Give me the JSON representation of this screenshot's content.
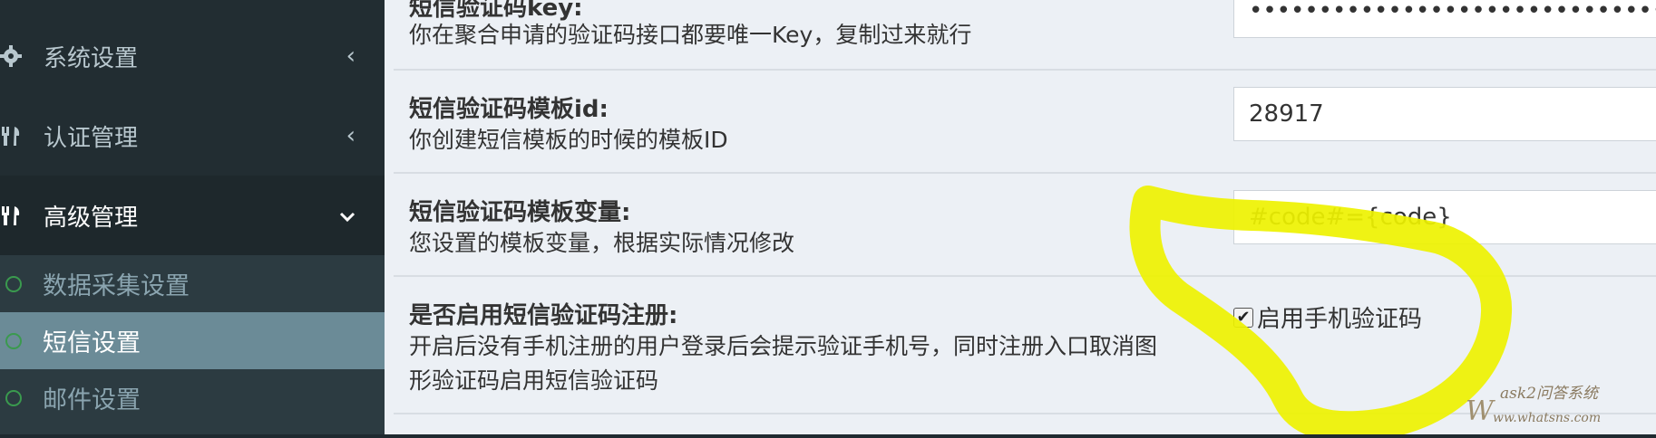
{
  "sidebar": {
    "items": [
      {
        "label": "系统设置",
        "icon": "gear-icon"
      },
      {
        "label": "认证管理",
        "icon": "cutlery-icon"
      },
      {
        "label": "高级管理",
        "icon": "cutlery-icon"
      }
    ],
    "subitems": [
      {
        "label": "数据采集设置"
      },
      {
        "label": "短信设置"
      },
      {
        "label": "邮件设置"
      }
    ]
  },
  "settings": {
    "key_title": "短信验证码key:",
    "key_desc": "你在聚合申请的验证码接口都要唯一Key，复制过来就行",
    "key_value": "••••••••••••••••••••••••••••••••",
    "template_id_title": "短信验证码模板id:",
    "template_id_desc": "你创建短信模板的时候的模板ID",
    "template_id_value": "28917",
    "template_var_title": "短信验证码模板变量:",
    "template_var_desc": "您设置的模板变量，根据实际情况修改",
    "template_var_value": "#code#={code}",
    "enable_title": "是否启用短信验证码注册:",
    "enable_desc_line1": "开启后没有手机注册的用户登录后会提示验证手机号，同时注册入口取消图",
    "enable_desc_line2": "形验证码启用短信验证码",
    "enable_checkbox_label": "启用手机验证码",
    "enable_checked": true
  },
  "watermark": {
    "brand": "ask2问答系统",
    "url": "www.whatsns.com"
  },
  "colors": {
    "sidebar_bg": "#222d32",
    "sidebar_sub_bg": "#2c3b41",
    "sidebar_selected_bg": "#6b8b97",
    "content_bg": "#ecf0f5",
    "highlight": "#eef200",
    "circle_green": "#3a9a4e"
  }
}
